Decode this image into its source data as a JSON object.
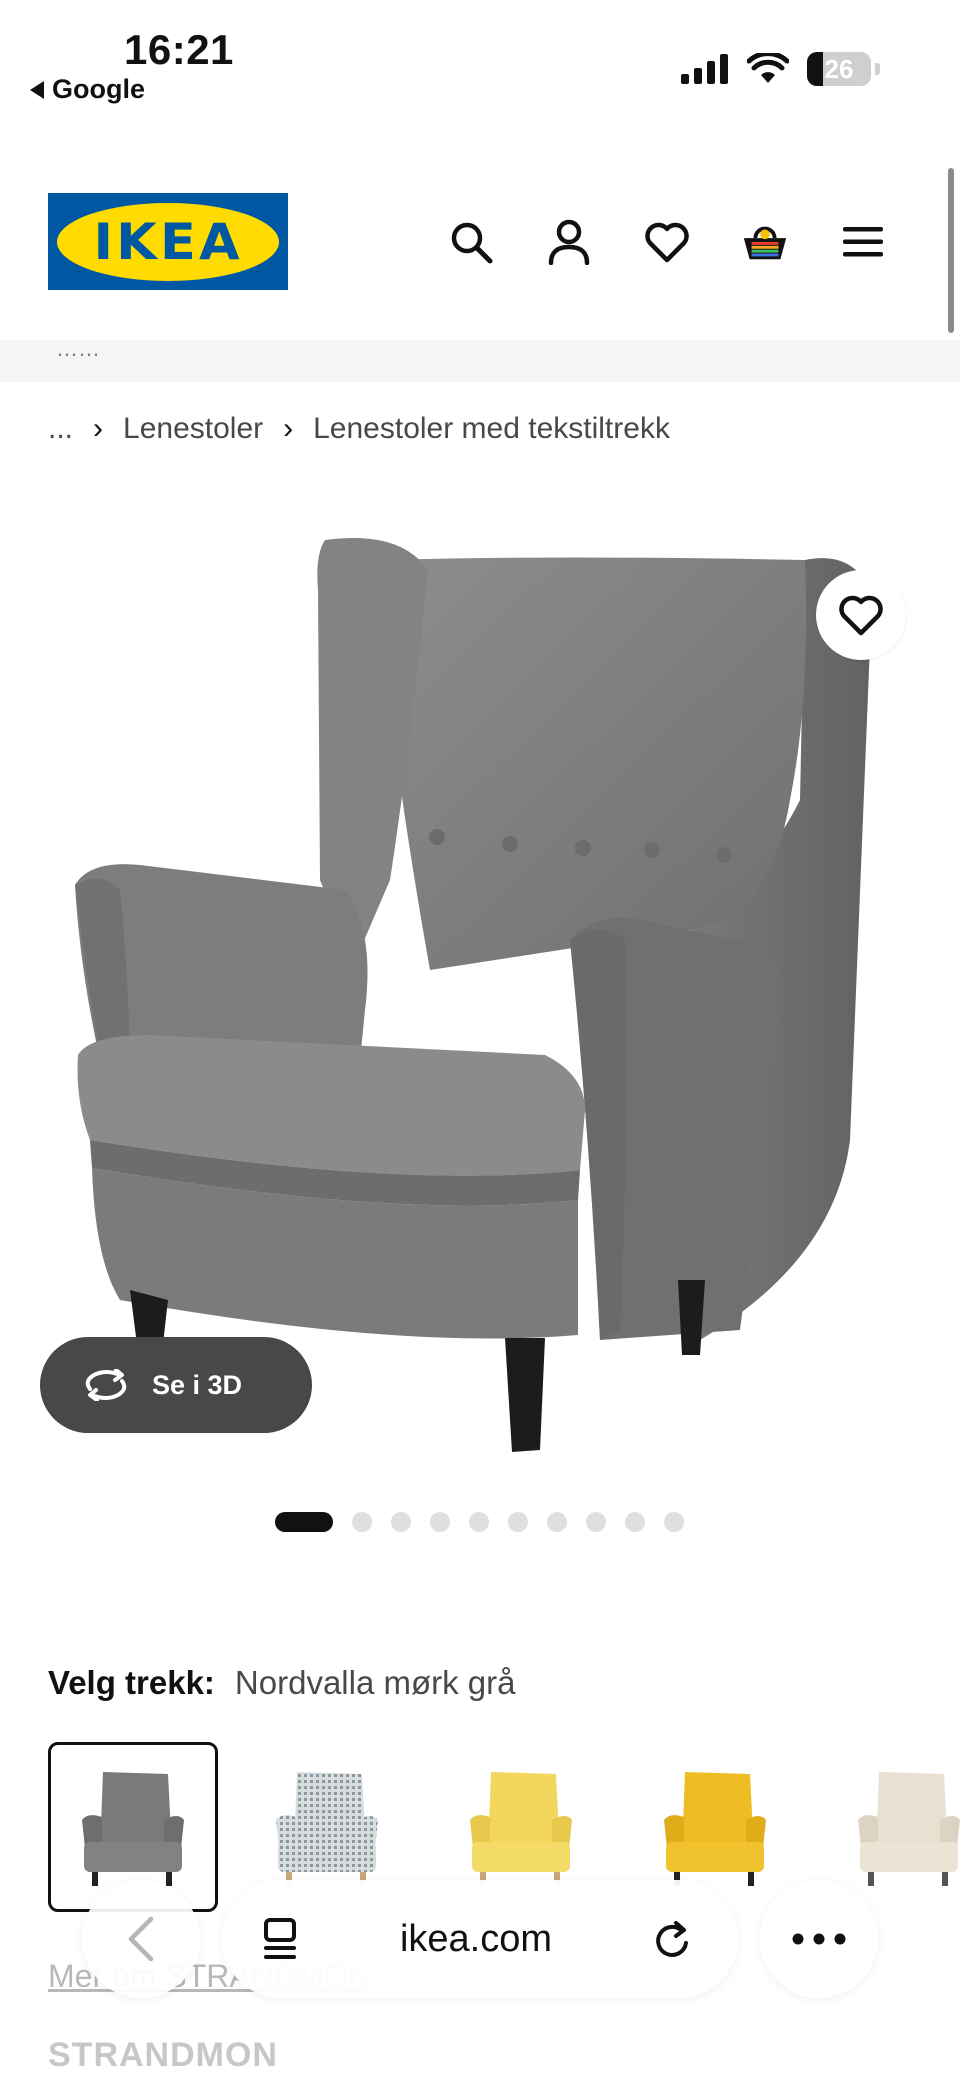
{
  "status_bar": {
    "time": "16:21",
    "back_app": "Google",
    "battery": "26",
    "icons": [
      "cellular-signal-icon",
      "wifi-icon",
      "battery-icon"
    ]
  },
  "header": {
    "logo_text": "IKEA",
    "icons": [
      "search-icon",
      "account-icon",
      "heart-icon",
      "basket-icon",
      "menu-icon"
    ]
  },
  "breadcrumb": {
    "items": [
      "...",
      "Lenestoler",
      "Lenestoler med tekstiltrekk"
    ]
  },
  "product_image": {
    "alt": "chair-image",
    "see_3d_label": "Se i 3D"
  },
  "carousel": {
    "total": 10,
    "active_index": 0
  },
  "variant": {
    "label": "Velg trekk:",
    "value": "Nordvalla mørk grå",
    "swatch_colors": [
      "#7a7a7c",
      "#b9c0c4",
      "#f0d35a",
      "#f0c22d",
      "#e6dfcf"
    ]
  },
  "faded": {
    "link": "Mer om STRANDMON",
    "product_name": "STRANDMON"
  },
  "safari": {
    "url": "ikea.com"
  },
  "colors": {
    "ikea_blue": "#0058a3",
    "ikea_yellow": "#ffdb00",
    "chair_grey": "#7b7b7d"
  }
}
